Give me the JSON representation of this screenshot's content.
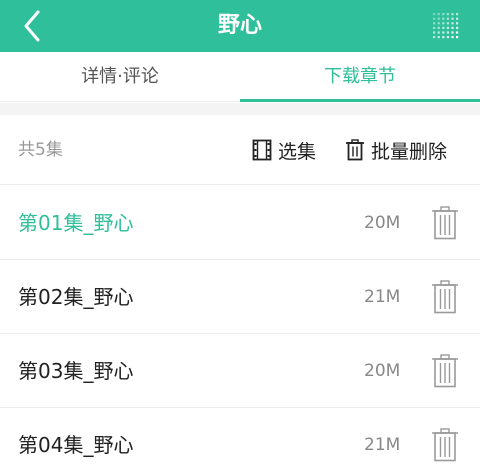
{
  "header": {
    "title": "野心",
    "back_icon": "chevron-left-icon",
    "menu_icon": "dot-grid-icon",
    "color": "#2fbf9a"
  },
  "tabs": [
    {
      "label": "详情·评论",
      "active": false
    },
    {
      "label": "下载章节",
      "active": true
    }
  ],
  "toolbar": {
    "count_label": "共5集",
    "select_label": "选集",
    "select_icon": "film-icon",
    "batch_delete_label": "批量删除",
    "batch_delete_icon": "trash-icon"
  },
  "episodes": [
    {
      "name": "第01集_野心",
      "size": "20M",
      "active": true
    },
    {
      "name": "第02集_野心",
      "size": "21M",
      "active": false
    },
    {
      "name": "第03集_野心",
      "size": "20M",
      "active": false
    },
    {
      "name": "第04集_野心",
      "size": "21M",
      "active": false
    }
  ],
  "colors": {
    "accent": "#2fbf9a",
    "text": "#222222",
    "muted": "#999999"
  }
}
